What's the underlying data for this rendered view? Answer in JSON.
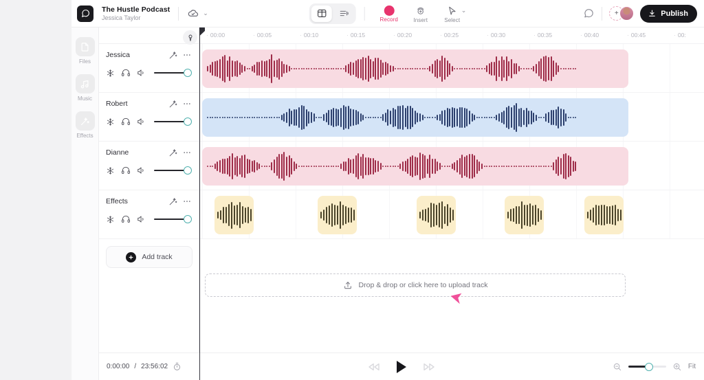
{
  "header": {
    "logo_icon": "chat-bubble-logo-icon",
    "project_title": "The Hustle Podcast",
    "project_owner": "Jessica Taylor",
    "cloud_icon": "cloud-check-icon",
    "cloud_chevron": "⌄",
    "view_toggle": [
      {
        "name": "grid-view",
        "icon": "grid-layout-icon",
        "active": true
      },
      {
        "name": "waveform-view",
        "icon": "waveform-list-icon",
        "active": false
      }
    ],
    "tools": [
      {
        "label": "Record",
        "icon": "record-dot-icon"
      },
      {
        "label": "Insert",
        "icon": "insert-circle-icon"
      },
      {
        "label": "Select",
        "icon": "cursor-arrow-icon"
      }
    ],
    "select_chevron": "⌄",
    "comment_icon": "comment-bubble-icon",
    "add_collaborator_label": "+",
    "avatar": "user-avatar",
    "publish_label": "Publish",
    "publish_icon": "download-icon"
  },
  "sidebar": {
    "items": [
      {
        "label": "Files",
        "icon": "files-icon"
      },
      {
        "label": "Music",
        "icon": "music-note-icon"
      },
      {
        "label": "Effects",
        "icon": "effects-wand-icon"
      }
    ]
  },
  "tracks": {
    "add_track_label": "Add track",
    "items": [
      {
        "name": "Jessica",
        "color": "pink",
        "enhance_icon": "magic-wand-icon",
        "more_icon": "more-options-icon",
        "controls": [
          "freeze-icon",
          "headphones-icon",
          "speaker-icon"
        ],
        "volume": 100
      },
      {
        "name": "Robert",
        "color": "blue",
        "enhance_icon": "magic-wand-icon",
        "more_icon": "more-options-icon",
        "controls": [
          "freeze-icon",
          "headphones-icon",
          "speaker-icon"
        ],
        "volume": 100
      },
      {
        "name": "Dianne",
        "color": "pink",
        "enhance_icon": "magic-wand-icon",
        "more_icon": "more-options-icon",
        "controls": [
          "freeze-icon",
          "headphones-icon",
          "speaker-icon"
        ],
        "volume": 100
      },
      {
        "name": "Effects",
        "color": "yellow",
        "enhance_icon": "magic-wand-icon",
        "more_icon": "more-options-icon",
        "controls": [
          "freeze-icon",
          "headphones-icon",
          "speaker-icon"
        ],
        "volume": 100
      }
    ]
  },
  "timeline": {
    "ruler_ticks": [
      "00:00",
      "00:05",
      "00:10",
      "00:15",
      "00:20",
      "00:25",
      "00:30",
      "00:35",
      "00:40",
      "00:45",
      "00:"
    ],
    "playhead_icon": "playhead-marker-icon",
    "playhead_position": "00:00",
    "dropzone_label": "Drop & drop or click here to upload track",
    "dropzone_icon": "upload-icon",
    "cursor_icon": "pink-cursor-arrow",
    "clips": [
      {
        "track": "Jessica",
        "color": "pink"
      },
      {
        "track": "Robert",
        "color": "blue"
      },
      {
        "track": "Dianne",
        "color": "pink"
      },
      {
        "track": "Effects",
        "color": "yellow",
        "count": 5
      }
    ]
  },
  "transport": {
    "current_time": "0:00:00",
    "separator": "/",
    "total_time": "23:56:02",
    "timer_icon": "stopwatch-icon",
    "rewind_icon": "rewind-icon",
    "play_icon": "play-icon",
    "forward_icon": "fast-forward-icon",
    "zoom_out_icon": "zoom-out-icon",
    "zoom_in_icon": "zoom-in-icon",
    "zoom_level": 45,
    "fit_label": "Fit"
  },
  "colors": {
    "accent_pink": "#e8336d",
    "clip_pink": "#f8dbe2",
    "clip_blue": "#d4e4f7",
    "clip_yellow": "#fbeeca",
    "publish_bg": "#17171b",
    "slider_knob": "#4fb0ae"
  }
}
